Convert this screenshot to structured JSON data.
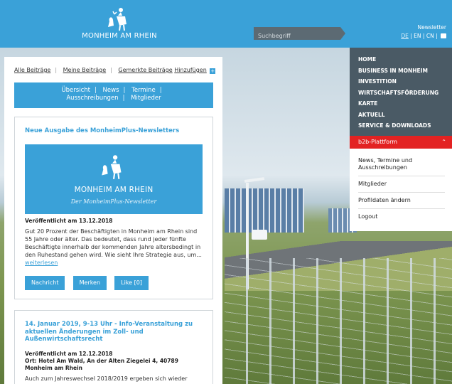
{
  "header": {
    "logo_text": "MONHEIM AM RHEIN",
    "search": {
      "placeholder": "Suchbegriff"
    },
    "newsletter_label": "Newsletter",
    "languages": [
      "DE",
      "EN",
      "CN"
    ]
  },
  "tabs_top": {
    "all": "Alle Beiträge",
    "mine": "Meine Beiträge",
    "saved": "Gemerkte Beiträge",
    "add": "Hinzufügen"
  },
  "subnav": {
    "items": [
      "Übersicht",
      "News",
      "Termine",
      "Ausschreibungen",
      "Mitglieder"
    ]
  },
  "card1": {
    "title": "Neue Ausgabe des MonheimPlus-Newsletters",
    "image_line1": "MONHEIM AM RHEIN",
    "image_line2": "Der MonheimPlus-Newsletter",
    "meta": "Veröffentlicht am 13.12.2018",
    "body": "Gut 20 Prozent der Beschäftigten in Monheim am Rhein sind 55 Jahre oder älter. Das bedeutet, dass rund jeder fünfte Beschäftigte innerhalb der kommenden Jahre altersbedingt in den Ruhestand gehen wird. Wie sieht Ihre Strategie aus, um...",
    "read_more": "weiterlesen",
    "buttons": {
      "message": "Nachricht",
      "bookmark": "Merken",
      "like": "Like [0]"
    }
  },
  "card2": {
    "title": "14. Januar 2019, 9-13 Uhr - Info-Veranstaltung zu aktuellen Änderungen im Zoll- und Außenwirtschaftsrecht",
    "meta1": "Veröffentlicht am 12.12.2018",
    "meta2": "Ort: Hotel Am Wald, An der Alten Ziegelei 4, 40789 Monheim am Rhein",
    "body": "Auch zum Jahreswechsel 2018/2019 ergeben sich wieder"
  },
  "right_nav": {
    "items": [
      "HOME",
      "BUSINESS IN MONHEIM",
      "INVESTITION",
      "WIRTSCHAFTSFÖRDERUNG",
      "KARTE",
      "AKTUELL",
      "SERVICE & DOWNLOADS"
    ]
  },
  "b2b": {
    "label": "b2b-Plattform",
    "items": [
      "News, Termine und Ausschreibungen",
      "Mitglieder",
      "Profildaten ändern",
      "Logout"
    ]
  },
  "colors": {
    "brand_blue": "#3aa1d8",
    "nav_gray": "#4a5a65",
    "accent_red": "#e32222"
  }
}
